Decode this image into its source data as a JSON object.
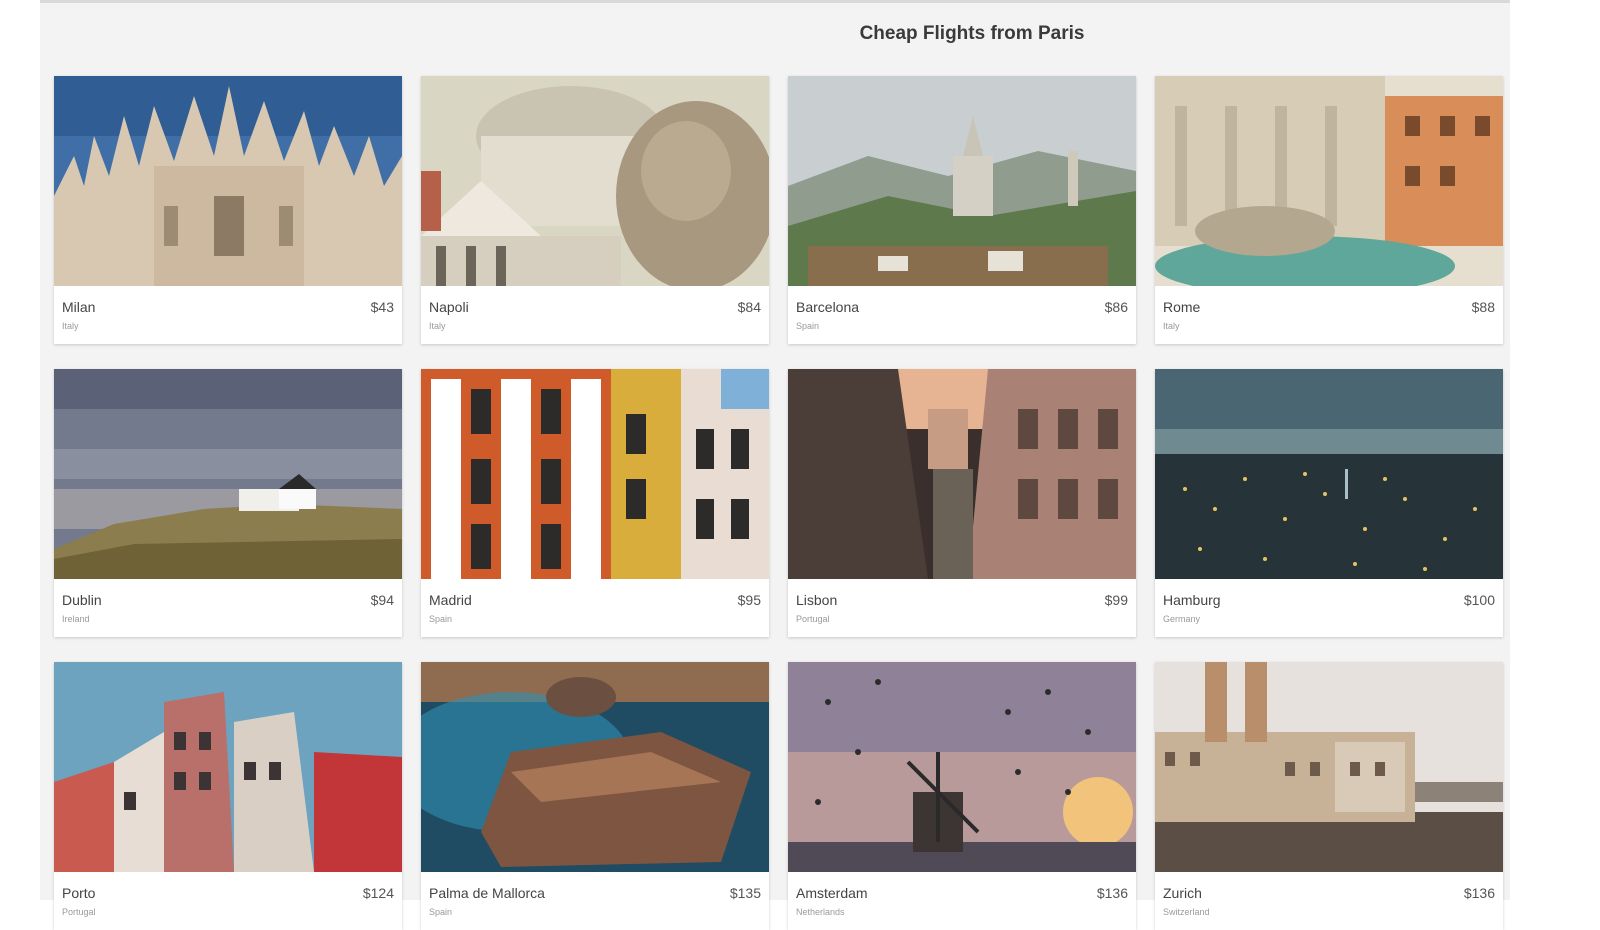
{
  "page": {
    "title": "Cheap Flights from Paris"
  },
  "destinations": [
    {
      "city": "Milan",
      "country": "Italy",
      "price": "$43"
    },
    {
      "city": "Napoli",
      "country": "Italy",
      "price": "$84"
    },
    {
      "city": "Barcelona",
      "country": "Spain",
      "price": "$86"
    },
    {
      "city": "Rome",
      "country": "Italy",
      "price": "$88"
    },
    {
      "city": "Dublin",
      "country": "Ireland",
      "price": "$94"
    },
    {
      "city": "Madrid",
      "country": "Spain",
      "price": "$95"
    },
    {
      "city": "Lisbon",
      "country": "Portugal",
      "price": "$99"
    },
    {
      "city": "Hamburg",
      "country": "Germany",
      "price": "$100"
    },
    {
      "city": "Porto",
      "country": "Portugal",
      "price": "$124"
    },
    {
      "city": "Palma de Mallorca",
      "country": "Spain",
      "price": "$135"
    },
    {
      "city": "Amsterdam",
      "country": "Netherlands",
      "price": "$136"
    },
    {
      "city": "Zurich",
      "country": "Switzerland",
      "price": "$136"
    }
  ]
}
